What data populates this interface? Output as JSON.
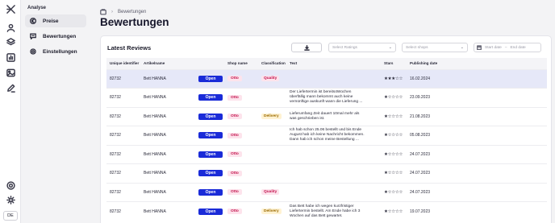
{
  "rail": {
    "lang": "DE"
  },
  "sidebar": {
    "section_title": "Analyse",
    "items": [
      {
        "label": "Preise",
        "icon": "euro-icon",
        "active": true
      },
      {
        "label": "Bewertungen",
        "icon": "comment-icon",
        "active": false
      },
      {
        "label": "Einstellungen",
        "icon": "gear-icon",
        "active": false
      }
    ]
  },
  "breadcrumb": {
    "current": "Bewertungen"
  },
  "page": {
    "title": "Bewertungen"
  },
  "reviews": {
    "title": "Latest Reviews",
    "filters": {
      "ratings_placeholder": "Select Ratings",
      "shops_placeholder": "Select shops",
      "start_date": "Start date",
      "end_date": "End date"
    },
    "columns": [
      "Unique identifier",
      "Artikelname",
      "",
      "Shop name",
      "Classification",
      "Text",
      "Stars",
      "Publishing date"
    ],
    "open_label": "Open",
    "rows": [
      {
        "id": "82732",
        "article": "Bett HANNA",
        "shop": "Otto",
        "classification": "Quality",
        "text": "",
        "stars": "★★★☆☆",
        "date": "16.02.2024"
      },
      {
        "id": "82732",
        "article": "Bett HANNA",
        "shop": "Otto",
        "classification": "",
        "text": "Der Liefertermin ist bereits4Wochen\nüberfällig mann bekommt auch keine\nvernünftige auskunft wann die Lieferung ...",
        "stars": "★☆☆☆☆",
        "date": "23.09.2023"
      },
      {
        "id": "82732",
        "article": "Bett HANNA",
        "shop": "Otto",
        "classification": "Delivery",
        "text": "Lieferumfang Zeit dauert 10mal mehr als\nwas geschrieben ist.",
        "stars": "★☆☆☆☆",
        "date": "21.08.2023"
      },
      {
        "id": "82732",
        "article": "Bett HANNA",
        "shop": "Otto",
        "classification": "",
        "text": "Ich hab schon 25.06 bestellt und bis Ende\nAugust hab ich keine Nachricht bekommen.\nDann hab ich schon meine Bestellung ...",
        "stars": "★☆☆☆☆",
        "date": "05.08.2023"
      },
      {
        "id": "82732",
        "article": "Bett HANNA",
        "shop": "Otto",
        "classification": "",
        "text": "",
        "stars": "★☆☆☆☆",
        "date": "24.07.2023"
      },
      {
        "id": "82732",
        "article": "Bett HANNA",
        "shop": "Otto",
        "classification": "",
        "text": "",
        "stars": "★☆☆☆☆",
        "date": "24.07.2023"
      },
      {
        "id": "82732",
        "article": "Bett HANNA",
        "shop": "Otto",
        "classification": "Quality",
        "text": "",
        "stars": "★☆☆☆☆",
        "date": "24.07.2023"
      },
      {
        "id": "82732",
        "article": "Bett HANNA",
        "shop": "Otto",
        "classification": "Delivery",
        "text": "Das Bett habe ich wegen kurzfristiger\nLiefertermin bestellt. Am Ende habe ich 3\nWochen auf das Bett gewartet.",
        "stars": "★☆☆☆☆",
        "date": "19.07.2023"
      }
    ]
  },
  "colors": {
    "accent": "#1a2bd8",
    "highlight_row": "#e6e8f8",
    "badge_pink": "#fde3ec",
    "badge_yellow": "#fff2d2"
  }
}
